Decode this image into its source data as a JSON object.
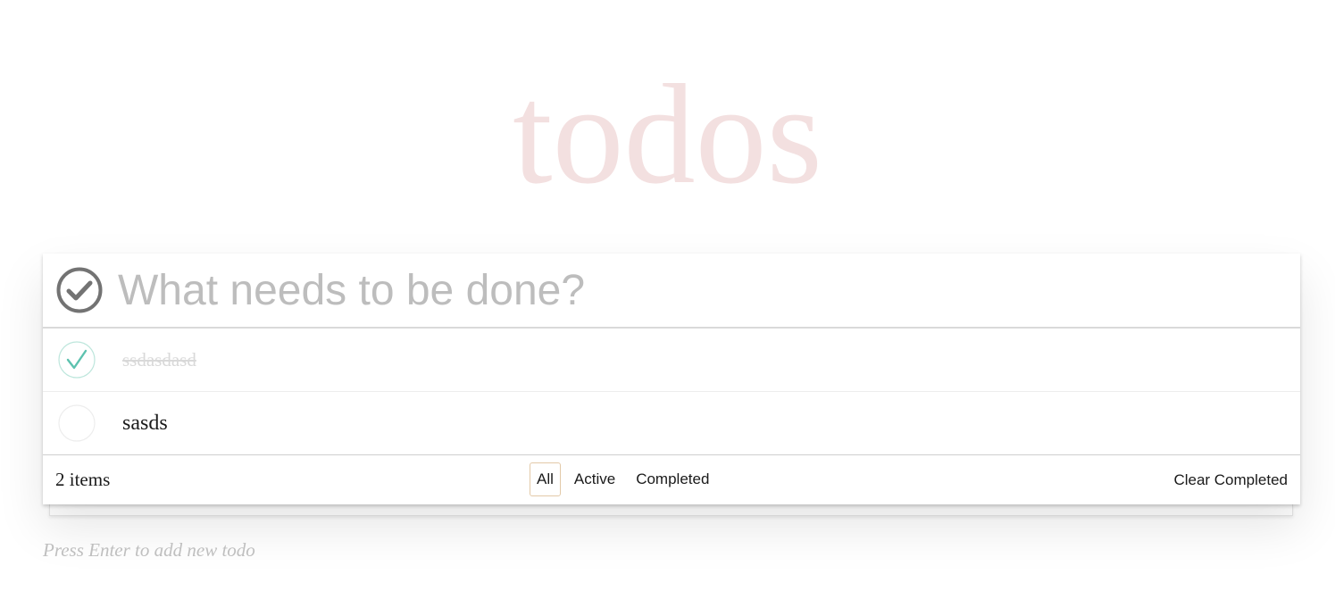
{
  "app": {
    "title": "todos"
  },
  "new_todo": {
    "placeholder": "What needs to be done?",
    "value": ""
  },
  "toggle_all_icon": "check-circle-icon",
  "todos": [
    {
      "label": "ssdasdasd",
      "completed": true
    },
    {
      "label": "sasds",
      "completed": false
    }
  ],
  "footer": {
    "items_count": "2 items",
    "filters": [
      {
        "label": "All",
        "selected": true
      },
      {
        "label": "Active",
        "selected": false
      },
      {
        "label": "Completed",
        "selected": false
      }
    ],
    "clear_completed": "Clear Completed"
  },
  "hint": "Press Enter to add new todo",
  "colors": {
    "title": "#f2dddd",
    "check": "#5dc2af",
    "toggle_all": "#737373",
    "selected_filter_border": "#e3c9a8"
  }
}
